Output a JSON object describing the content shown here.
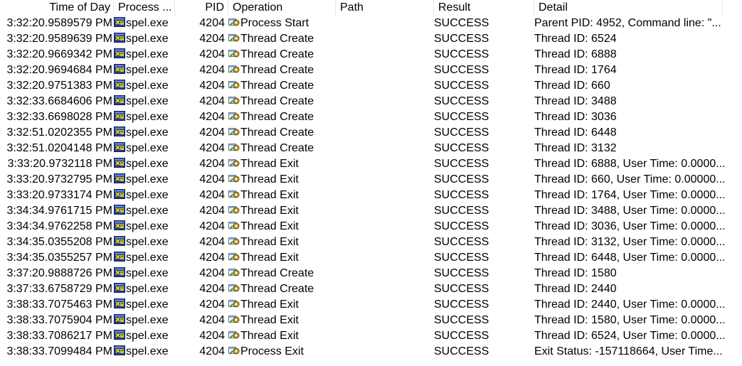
{
  "columns": {
    "time": "Time of Day",
    "process": "Process ...",
    "pid": "PID",
    "operation": "Operation",
    "path": "Path",
    "result": "Result",
    "detail": "Detail"
  },
  "icons": {
    "process": "process-window-icon",
    "operation": "thread-gear-icon"
  },
  "events": [
    {
      "time": "3:32:20.9589579 PM",
      "process": "spel.exe",
      "pid": "4204",
      "operation": "Process Start",
      "path": "",
      "result": "SUCCESS",
      "detail": "Parent PID: 4952, Command line: \"..."
    },
    {
      "time": "3:32:20.9589639 PM",
      "process": "spel.exe",
      "pid": "4204",
      "operation": "Thread Create",
      "path": "",
      "result": "SUCCESS",
      "detail": "Thread ID: 6524"
    },
    {
      "time": "3:32:20.9669342 PM",
      "process": "spel.exe",
      "pid": "4204",
      "operation": "Thread Create",
      "path": "",
      "result": "SUCCESS",
      "detail": "Thread ID: 6888"
    },
    {
      "time": "3:32:20.9694684 PM",
      "process": "spel.exe",
      "pid": "4204",
      "operation": "Thread Create",
      "path": "",
      "result": "SUCCESS",
      "detail": "Thread ID: 1764"
    },
    {
      "time": "3:32:20.9751383 PM",
      "process": "spel.exe",
      "pid": "4204",
      "operation": "Thread Create",
      "path": "",
      "result": "SUCCESS",
      "detail": "Thread ID: 660"
    },
    {
      "time": "3:32:33.6684606 PM",
      "process": "spel.exe",
      "pid": "4204",
      "operation": "Thread Create",
      "path": "",
      "result": "SUCCESS",
      "detail": "Thread ID: 3488"
    },
    {
      "time": "3:32:33.6698028 PM",
      "process": "spel.exe",
      "pid": "4204",
      "operation": "Thread Create",
      "path": "",
      "result": "SUCCESS",
      "detail": "Thread ID: 3036"
    },
    {
      "time": "3:32:51.0202355 PM",
      "process": "spel.exe",
      "pid": "4204",
      "operation": "Thread Create",
      "path": "",
      "result": "SUCCESS",
      "detail": "Thread ID: 6448"
    },
    {
      "time": "3:32:51.0204148 PM",
      "process": "spel.exe",
      "pid": "4204",
      "operation": "Thread Create",
      "path": "",
      "result": "SUCCESS",
      "detail": "Thread ID: 3132"
    },
    {
      "time": "3:33:20.9732118 PM",
      "process": "spel.exe",
      "pid": "4204",
      "operation": "Thread Exit",
      "path": "",
      "result": "SUCCESS",
      "detail": "Thread ID: 6888, User Time: 0.0000..."
    },
    {
      "time": "3:33:20.9732795 PM",
      "process": "spel.exe",
      "pid": "4204",
      "operation": "Thread Exit",
      "path": "",
      "result": "SUCCESS",
      "detail": "Thread ID: 660, User Time: 0.00000..."
    },
    {
      "time": "3:33:20.9733174 PM",
      "process": "spel.exe",
      "pid": "4204",
      "operation": "Thread Exit",
      "path": "",
      "result": "SUCCESS",
      "detail": "Thread ID: 1764, User Time: 0.0000..."
    },
    {
      "time": "3:34:34.9761715 PM",
      "process": "spel.exe",
      "pid": "4204",
      "operation": "Thread Exit",
      "path": "",
      "result": "SUCCESS",
      "detail": "Thread ID: 3488, User Time: 0.0000..."
    },
    {
      "time": "3:34:34.9762258 PM",
      "process": "spel.exe",
      "pid": "4204",
      "operation": "Thread Exit",
      "path": "",
      "result": "SUCCESS",
      "detail": "Thread ID: 3036, User Time: 0.0000..."
    },
    {
      "time": "3:34:35.0355208 PM",
      "process": "spel.exe",
      "pid": "4204",
      "operation": "Thread Exit",
      "path": "",
      "result": "SUCCESS",
      "detail": "Thread ID: 3132, User Time: 0.0000..."
    },
    {
      "time": "3:34:35.0355257 PM",
      "process": "spel.exe",
      "pid": "4204",
      "operation": "Thread Exit",
      "path": "",
      "result": "SUCCESS",
      "detail": "Thread ID: 6448, User Time: 0.0000..."
    },
    {
      "time": "3:37:20.9888726 PM",
      "process": "spel.exe",
      "pid": "4204",
      "operation": "Thread Create",
      "path": "",
      "result": "SUCCESS",
      "detail": "Thread ID: 1580"
    },
    {
      "time": "3:37:33.6758729 PM",
      "process": "spel.exe",
      "pid": "4204",
      "operation": "Thread Create",
      "path": "",
      "result": "SUCCESS",
      "detail": "Thread ID: 2440"
    },
    {
      "time": "3:38:33.7075463 PM",
      "process": "spel.exe",
      "pid": "4204",
      "operation": "Thread Exit",
      "path": "",
      "result": "SUCCESS",
      "detail": "Thread ID: 2440, User Time: 0.0000..."
    },
    {
      "time": "3:38:33.7075904 PM",
      "process": "spel.exe",
      "pid": "4204",
      "operation": "Thread Exit",
      "path": "",
      "result": "SUCCESS",
      "detail": "Thread ID: 1580, User Time: 0.0000..."
    },
    {
      "time": "3:38:33.7086217 PM",
      "process": "spel.exe",
      "pid": "4204",
      "operation": "Thread Exit",
      "path": "",
      "result": "SUCCESS",
      "detail": "Thread ID: 6524, User Time: 0.0000..."
    },
    {
      "time": "3:38:33.7099484 PM",
      "process": "spel.exe",
      "pid": "4204",
      "operation": "Process Exit",
      "path": "",
      "result": "SUCCESS",
      "detail": "Exit Status: -157118664, User Time..."
    }
  ]
}
